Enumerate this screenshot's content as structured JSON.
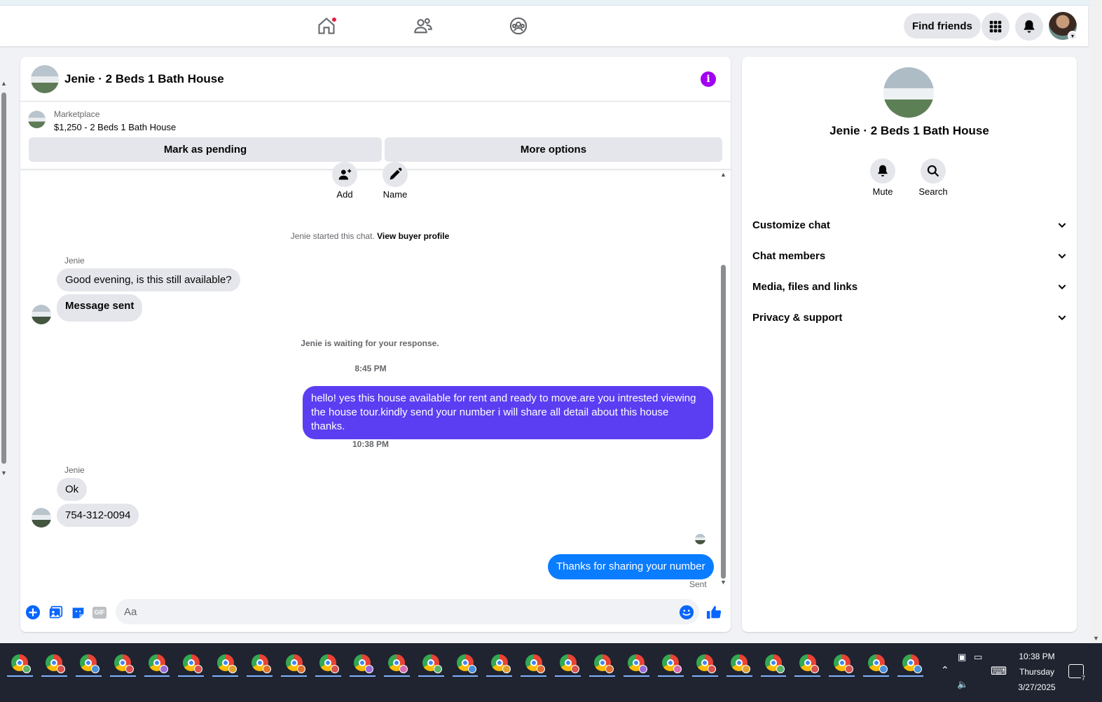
{
  "navbar": {
    "find_friends": "Find friends",
    "colors": {
      "active": "#1877f2",
      "icon": "#65676b"
    }
  },
  "chat": {
    "title": "Jenie · 2 Beds 1 Bath House",
    "marketplace_label": "Marketplace",
    "listing": "$1,250 - 2 Beds 1 Bath House",
    "mark_pending": "Mark as pending",
    "more_options": "More options",
    "actions": {
      "add": "Add",
      "name": "Name"
    },
    "started_text": "Jenie started this chat.",
    "view_buyer": "View buyer profile",
    "waiting_text": "Jenie is waiting for your response.",
    "messages": [
      {
        "sender": "Jenie",
        "text": "Good evening, is this still available?"
      },
      {
        "text": "Message sent"
      },
      {
        "time": "8:45 PM"
      },
      {
        "text": "hello! yes this house available for rent and ready to move.are you intrested viewing the house tour.kindly send your number i will share all detail about this house thanks.",
        "color": "#5b3ef2"
      },
      {
        "time": "10:38 PM"
      },
      {
        "sender": "Jenie",
        "text": "Ok"
      },
      {
        "text": "754-312-0094"
      },
      {
        "text": "Thanks for sharing your number",
        "color": "#0a7cff"
      }
    ],
    "sent_status": "Sent",
    "composer_placeholder": "Aa",
    "gif_label": "GIF"
  },
  "info_panel": {
    "title": "Jenie · 2 Beds 1 Bath House",
    "mute": "Mute",
    "search": "Search",
    "sections": [
      "Customize chat",
      "Chat members",
      "Media, files and links",
      "Privacy & support"
    ]
  },
  "taskbar": {
    "time": "10:38 PM",
    "day": "Thursday",
    "date": "3/27/2025",
    "notifications": "7",
    "badge_colors": [
      "#5bb26a",
      "#d9534f",
      "#4a90d9",
      "#d9534f",
      "#9b6ad9",
      "#d9534f",
      "#e0a030",
      "#e07030",
      "#e07030",
      "#d9534f",
      "#9b6ad9",
      "#d96ab0",
      "#5bb26a",
      "#4a90d9",
      "#e0a030",
      "#e07030",
      "#d9534f",
      "#e07030",
      "#9b6ad9",
      "#d96ab0",
      "#d9534f",
      "#e0a030",
      "#5bb26a",
      "#d9534f",
      "#d9534f",
      "#4a90d9",
      "#4a90d9"
    ]
  }
}
